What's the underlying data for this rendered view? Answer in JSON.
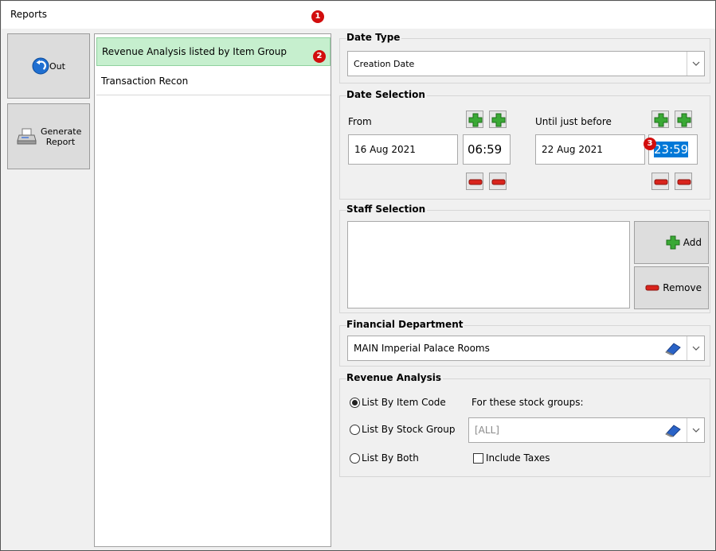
{
  "window": {
    "title": "Reports"
  },
  "annotations": {
    "m1": "1",
    "m2": "2",
    "m3": "3"
  },
  "left": {
    "out_label": "Out",
    "generate_label": "Generate Report"
  },
  "reports_list": [
    {
      "label": "Revenue Analysis listed by Item Group",
      "selected": true
    },
    {
      "label": "Transaction Recon",
      "selected": false
    }
  ],
  "date_type": {
    "title": "Date Type",
    "value": "Creation Date"
  },
  "date_selection": {
    "title": "Date Selection",
    "from_label": "From",
    "from_date": "16 Aug 2021",
    "from_time": "06:59",
    "until_label": "Until just before",
    "until_date": "22 Aug 2021",
    "until_time": "23:59"
  },
  "staff_selection": {
    "title": "Staff Selection",
    "add_label": "Add",
    "remove_label": "Remove"
  },
  "financial_department": {
    "title": "Financial Department",
    "value": "MAIN Imperial Palace Rooms"
  },
  "revenue_analysis": {
    "title": "Revenue Analysis",
    "option_item_code": "List By Item Code",
    "option_stock_group": "List By Stock Group",
    "option_both": "List By Both",
    "selected": "item_code",
    "stock_groups_label": "For these stock groups:",
    "stock_groups_value": "[ALL]",
    "include_taxes_label": "Include Taxes",
    "include_taxes": false
  },
  "colors": {
    "selected_item_bg": "#c6efce",
    "highlight_time_bg": "#0078d7",
    "plus_green": "#3aa935",
    "minus_red": "#d9241c",
    "badge_red": "#d20d0d"
  }
}
